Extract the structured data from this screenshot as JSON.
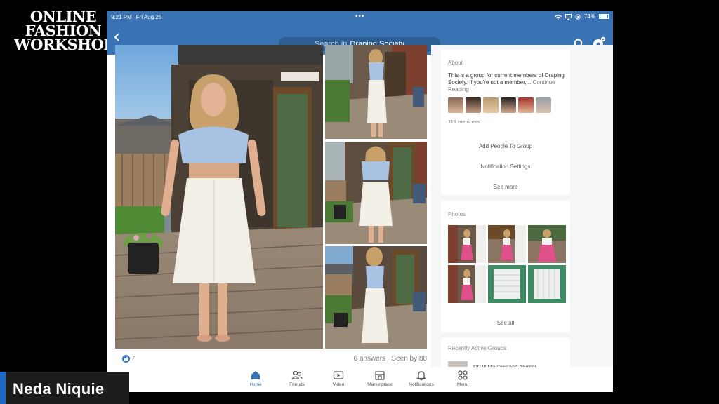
{
  "logo": {
    "line1": "ONLINE",
    "line2": "FASHION",
    "line3": "WORKSHOP"
  },
  "status_bar": {
    "time": "9:21 PM",
    "date": "Fri Aug 25",
    "battery": "74%"
  },
  "header": {
    "search_prefix": "Search in",
    "group_name": "Draping Society"
  },
  "post": {
    "likes": "7",
    "answers_seen": "6 answers   Seen by 88"
  },
  "about": {
    "title": "About",
    "description": "This is a group for current members of Draping Society. If you're not a member,...",
    "continue_label": "Continue Reading",
    "members_count": "118 members",
    "add_people": "Add People To Group",
    "notification_settings": "Notification Settings",
    "see_more": "See more"
  },
  "photos": {
    "title": "Photos",
    "see_all": "See all"
  },
  "recent": {
    "title": "Recently Active Groups",
    "first_group": "DCM Masterclass Alumni"
  },
  "tabs": [
    {
      "label": "Home",
      "icon": "home-icon"
    },
    {
      "label": "Friends",
      "icon": "friends-icon"
    },
    {
      "label": "Video",
      "icon": "video-icon"
    },
    {
      "label": "Marketplace",
      "icon": "marketplace-icon"
    },
    {
      "label": "Notifications",
      "icon": "bell-icon"
    },
    {
      "label": "Menu",
      "icon": "menu-grid-icon"
    }
  ],
  "speaker": {
    "name": "Neda Niquie"
  },
  "colors": {
    "brand_blue": "#3a73b3",
    "name_tag_accent": "#1e66c6"
  }
}
